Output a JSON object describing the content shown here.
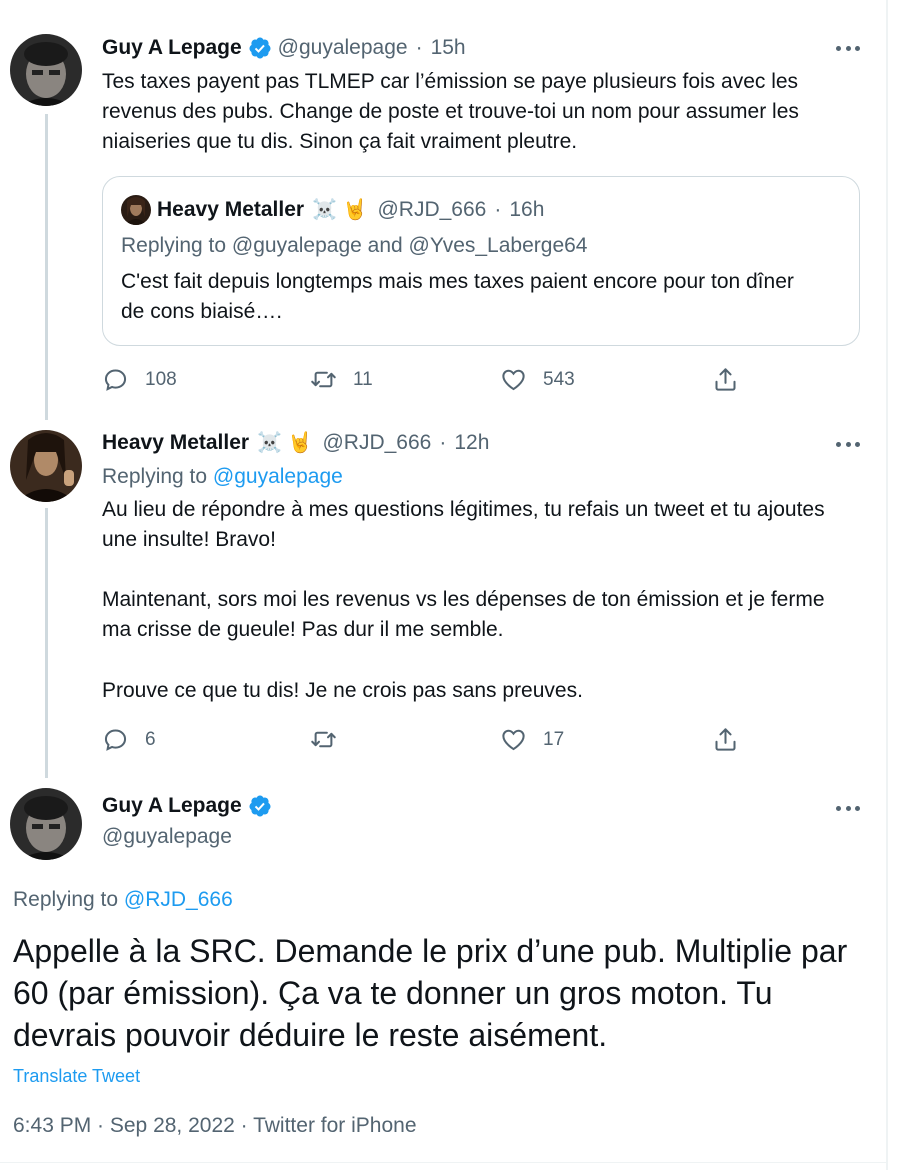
{
  "tweet1": {
    "author_name": "Guy A Lepage",
    "author_handle": "@guyalepage",
    "time": "15h",
    "text": "Tes taxes payent pas TLMEP car l’émission se paye plusieurs fois avec les revenus des pubs. Change de poste et trouve-toi un nom pour assumer les niaiseries que tu dis. Sinon ça fait vraiment pleutre.",
    "quoted": {
      "author_name": "Heavy Metaller",
      "emoji": "☠️ 🤘",
      "author_handle": "@RJD_666",
      "time": "16h",
      "replying_prefix": "Replying to",
      "replying_to": "@guyalepage and @Yves_Laberge64",
      "text": "C'est fait depuis longtemps mais mes taxes paient encore pour ton dîner de cons biaisé…."
    },
    "actions": {
      "replies": "108",
      "retweets": "11",
      "likes": "543"
    }
  },
  "tweet2": {
    "author_name": "Heavy Metaller",
    "emoji": "☠️ 🤘",
    "author_handle": "@RJD_666",
    "time": "12h",
    "replying_prefix": "Replying to",
    "replying_to": "@guyalepage",
    "paragraphs": [
      "Au lieu de répondre à mes questions légitimes, tu refais un tweet et tu ajoutes une insulte!  Bravo!",
      "Maintenant, sors moi les revenus vs les dépenses de ton émission et je ferme ma crisse de gueule!  Pas dur il me semble.",
      "Prouve ce que tu dis!  Je ne crois pas sans preuves."
    ],
    "actions": {
      "replies": "6",
      "retweets": "",
      "likes": "17"
    }
  },
  "main_tweet": {
    "author_name": "Guy A Lepage",
    "author_handle": "@guyalepage",
    "replying_prefix": "Replying to",
    "replying_to": "@RJD_666",
    "text": "Appelle à la SRC. Demande le prix d’une pub. Multiplie par 60 (par émission). Ça va te donner un gros moton. Tu devrais pouvoir déduire le reste aisément.",
    "translate_label": "Translate Tweet",
    "timestamp": "6:43 PM · Sep 28, 2022 · Twitter for iPhone"
  },
  "colors": {
    "accent": "#1d9bf0",
    "muted": "#536471",
    "border": "#cfd9de"
  },
  "separator": "·"
}
